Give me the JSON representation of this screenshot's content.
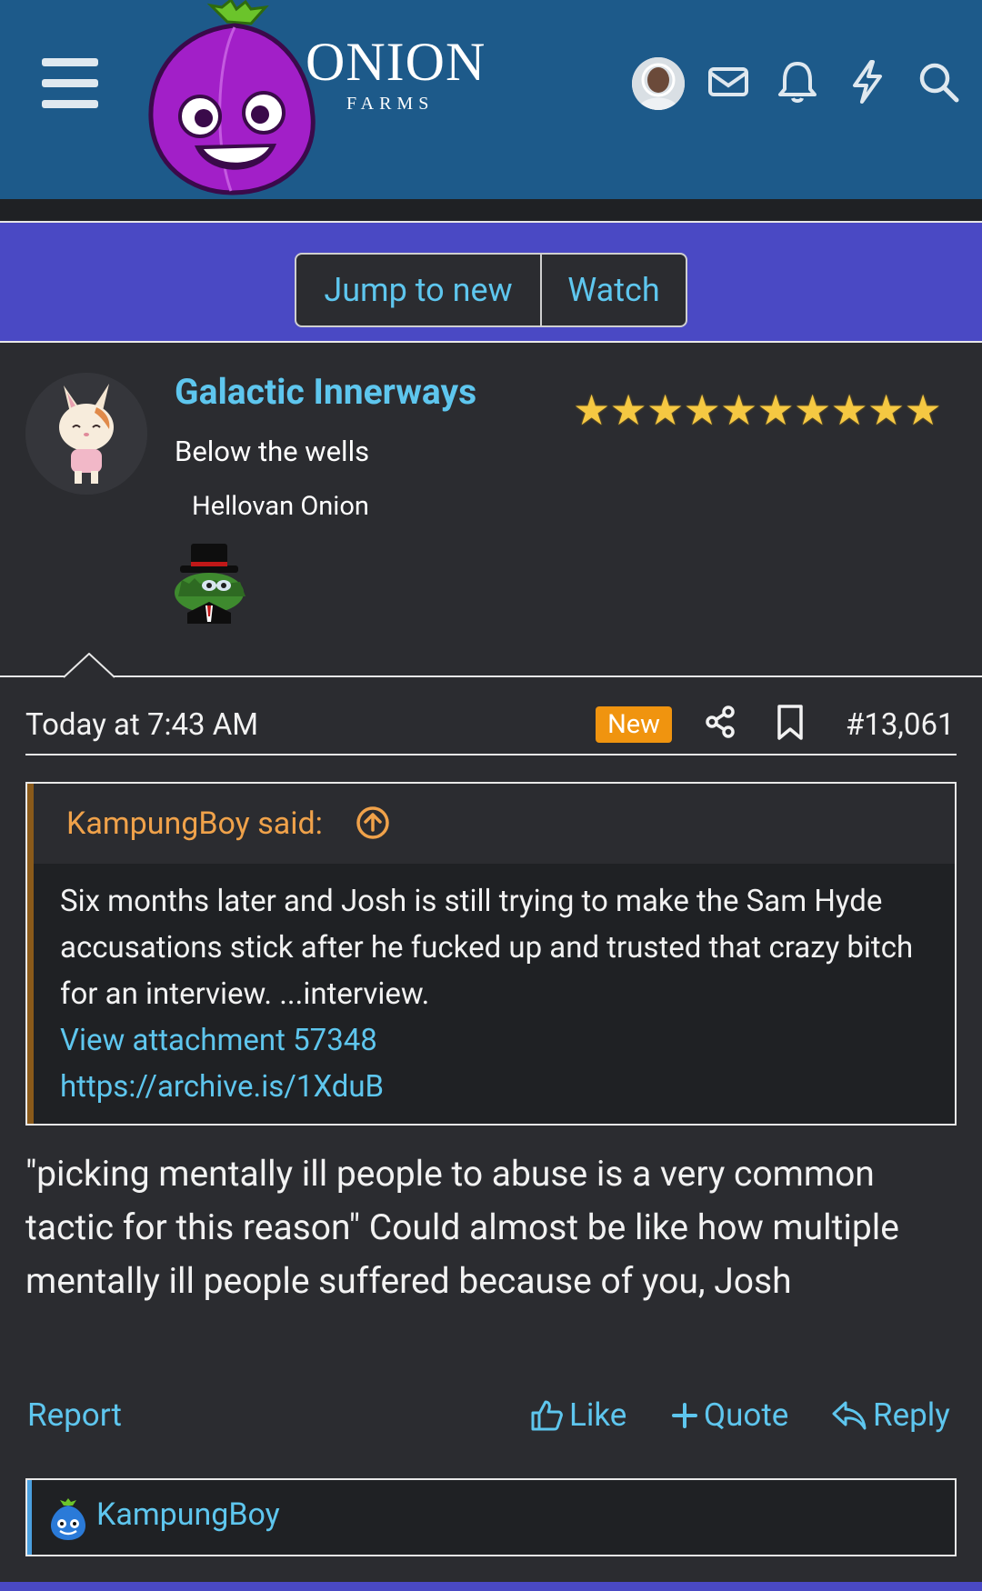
{
  "header": {
    "brand_main": "ONION",
    "brand_sub": "FARMS",
    "colors": {
      "header_bg": "#1d5a8a",
      "nav_bg": "#4a49c4",
      "link": "#5ec6ee"
    }
  },
  "nav": {
    "jump_label": "Jump to new",
    "watch_label": "Watch"
  },
  "post": {
    "author": {
      "name": "Galactic Innerways",
      "title": "Below the wells",
      "rank": "Hellovan Onion",
      "stars": [
        "★",
        "★",
        "★",
        "★",
        "★",
        "★",
        "★",
        "★",
        "★",
        "★"
      ]
    },
    "date": "Today at 7:43 AM",
    "new_badge": "New",
    "number": "#13,061",
    "quote": {
      "author": "KampungBoy said:",
      "text": "Six months later and Josh is still trying to make the Sam Hyde accusations stick after he fucked up and trusted that crazy bitch for an interview. ...interview.",
      "attachment": "View attachment 57348",
      "link": "https://archive.is/1XduB"
    },
    "body": "\"picking mentally ill people to abuse is a very common tactic for this reason\" Could almost be like how multiple mentally ill people suffered because of you, Josh",
    "actions": {
      "report": "Report",
      "like": "Like",
      "quote": "Quote",
      "reply": "Reply"
    },
    "reactions": {
      "user": "KampungBoy"
    }
  }
}
